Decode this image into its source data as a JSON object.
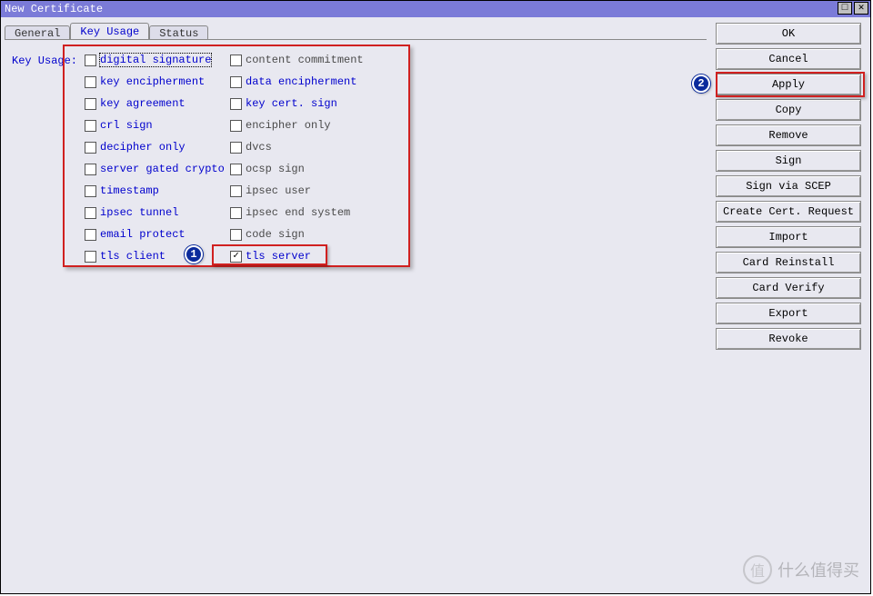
{
  "window": {
    "title": "New Certificate"
  },
  "tabs": {
    "items": [
      {
        "label": "General"
      },
      {
        "label": "Key Usage"
      },
      {
        "label": "Status"
      }
    ],
    "active_index": 1
  },
  "form": {
    "label": "Key Usage:"
  },
  "key_usage": {
    "col1": [
      {
        "label": "digital signature",
        "checked": false,
        "focused": true
      },
      {
        "label": "key encipherment",
        "checked": false
      },
      {
        "label": "key agreement",
        "checked": false
      },
      {
        "label": "crl sign",
        "checked": false
      },
      {
        "label": "decipher only",
        "checked": false
      },
      {
        "label": "server gated crypto",
        "checked": false
      },
      {
        "label": "timestamp",
        "checked": false
      },
      {
        "label": "ipsec tunnel",
        "checked": false
      },
      {
        "label": "email protect",
        "checked": false
      },
      {
        "label": "tls client",
        "checked": false
      }
    ],
    "col2": [
      {
        "label": "content commitment",
        "checked": false,
        "gray": true
      },
      {
        "label": "data encipherment",
        "checked": false
      },
      {
        "label": "key cert. sign",
        "checked": false
      },
      {
        "label": "encipher only",
        "checked": false,
        "gray": true
      },
      {
        "label": "dvcs",
        "checked": false,
        "gray": true
      },
      {
        "label": "ocsp sign",
        "checked": false,
        "gray": true
      },
      {
        "label": "ipsec user",
        "checked": false,
        "gray": true
      },
      {
        "label": "ipsec end system",
        "checked": false,
        "gray": true
      },
      {
        "label": "code sign",
        "checked": false,
        "gray": true
      },
      {
        "label": "tls server",
        "checked": true
      }
    ]
  },
  "sidebar": {
    "buttons": [
      "OK",
      "Cancel",
      "Apply",
      "Copy",
      "Remove",
      "Sign",
      "Sign via SCEP",
      "Create Cert. Request",
      "Import",
      "Card Reinstall",
      "Card Verify",
      "Export",
      "Revoke"
    ]
  },
  "annotations": {
    "step1": "1",
    "step2": "2"
  },
  "watermark": {
    "icon": "值",
    "text": "什么值得买"
  }
}
